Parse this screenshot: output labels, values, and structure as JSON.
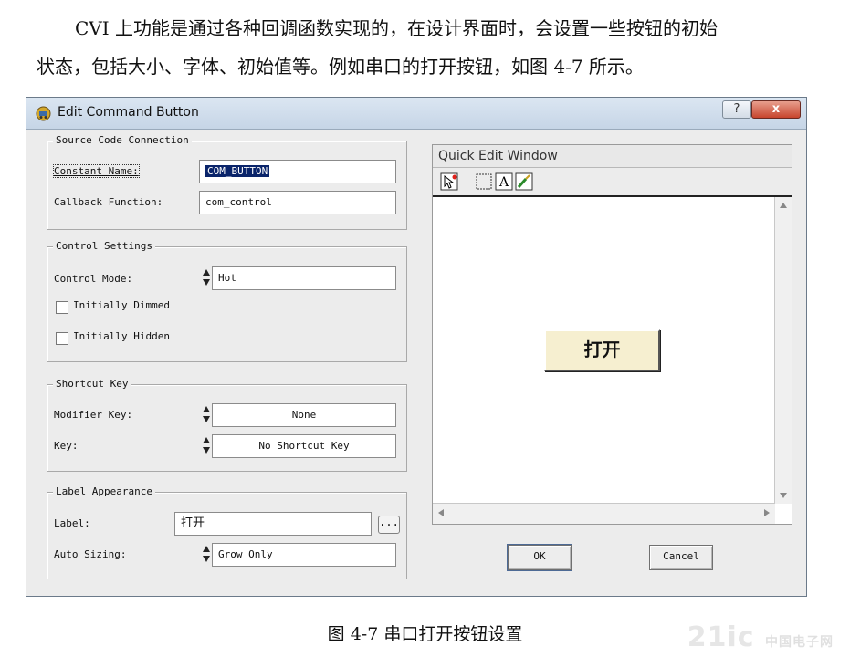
{
  "intro": {
    "line1": "CVI 上功能是通过各种回调函数实现的，在设计界面时，会设置一些按钮的初始",
    "line2": "状态，包括大小、字体、初始值等。例如串口的打开按钮，如图 4-7 所示。"
  },
  "dialog": {
    "title": "Edit Command Button",
    "help_label": "?",
    "close_label": "x",
    "source_group": {
      "title": "Source Code Connection",
      "constant_name_label": "Constant Name:",
      "constant_name_value": "COM_BUTTON",
      "callback_label": "Callback Function:",
      "callback_value": "com_control"
    },
    "control_group": {
      "title": "Control Settings",
      "mode_label": "Control Mode:",
      "mode_value": "Hot",
      "dimmed_label": "Initially Dimmed",
      "hidden_label": "Initially Hidden"
    },
    "shortcut_group": {
      "title": "Shortcut Key",
      "modifier_label": "Modifier Key:",
      "modifier_value": "None",
      "key_label": "Key:",
      "key_value": "No Shortcut Key"
    },
    "label_group": {
      "title": "Label Appearance",
      "label_label": "Label:",
      "label_value": "打开",
      "browse_label": "...",
      "sizing_label": "Auto Sizing:",
      "sizing_value": "Grow Only"
    },
    "quick_edit": {
      "title": "Quick Edit Window",
      "preview_button_label": "打开"
    },
    "ok_label": "OK",
    "cancel_label": "Cancel"
  },
  "caption": "图  4-7  串口打开按钮设置",
  "watermark": {
    "main": "21ic",
    "sub": "中国电子网"
  }
}
